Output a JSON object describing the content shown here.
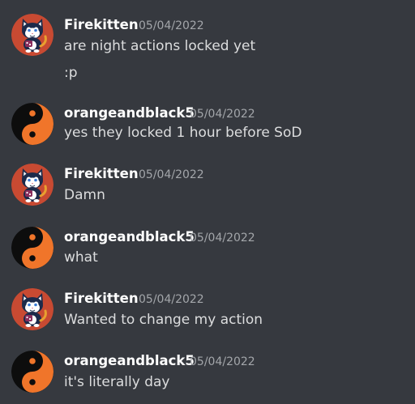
{
  "colors": {
    "background": "#36393f",
    "username": "#ffffff",
    "timestamp": "#a3a6aa",
    "message_text": "#dcddde",
    "kitten_avatar_bg": "#c84a32",
    "yinyang_orange": "#f0752a",
    "yinyang_black": "#0d0d0d"
  },
  "messages": [
    {
      "avatar_icon": "cat-avatar-icon",
      "username": "Firekitten",
      "timestamp": "05/04/2022",
      "lines": [
        "are night actions locked yet",
        ":p"
      ]
    },
    {
      "avatar_icon": "yin-yang-avatar-icon",
      "username": "orangeandblack5",
      "timestamp": "05/04/2022",
      "lines": [
        "yes they locked 1 hour before SoD"
      ]
    },
    {
      "avatar_icon": "cat-avatar-icon",
      "username": "Firekitten",
      "timestamp": "05/04/2022",
      "lines": [
        "Damn"
      ]
    },
    {
      "avatar_icon": "yin-yang-avatar-icon",
      "username": "orangeandblack5",
      "timestamp": "05/04/2022",
      "lines": [
        "what"
      ]
    },
    {
      "avatar_icon": "cat-avatar-icon",
      "username": "Firekitten",
      "timestamp": "05/04/2022",
      "lines": [
        "Wanted to change my action"
      ]
    },
    {
      "avatar_icon": "yin-yang-avatar-icon",
      "username": "orangeandblack5",
      "timestamp": "05/04/2022",
      "lines": [
        "it's literally day"
      ]
    }
  ]
}
